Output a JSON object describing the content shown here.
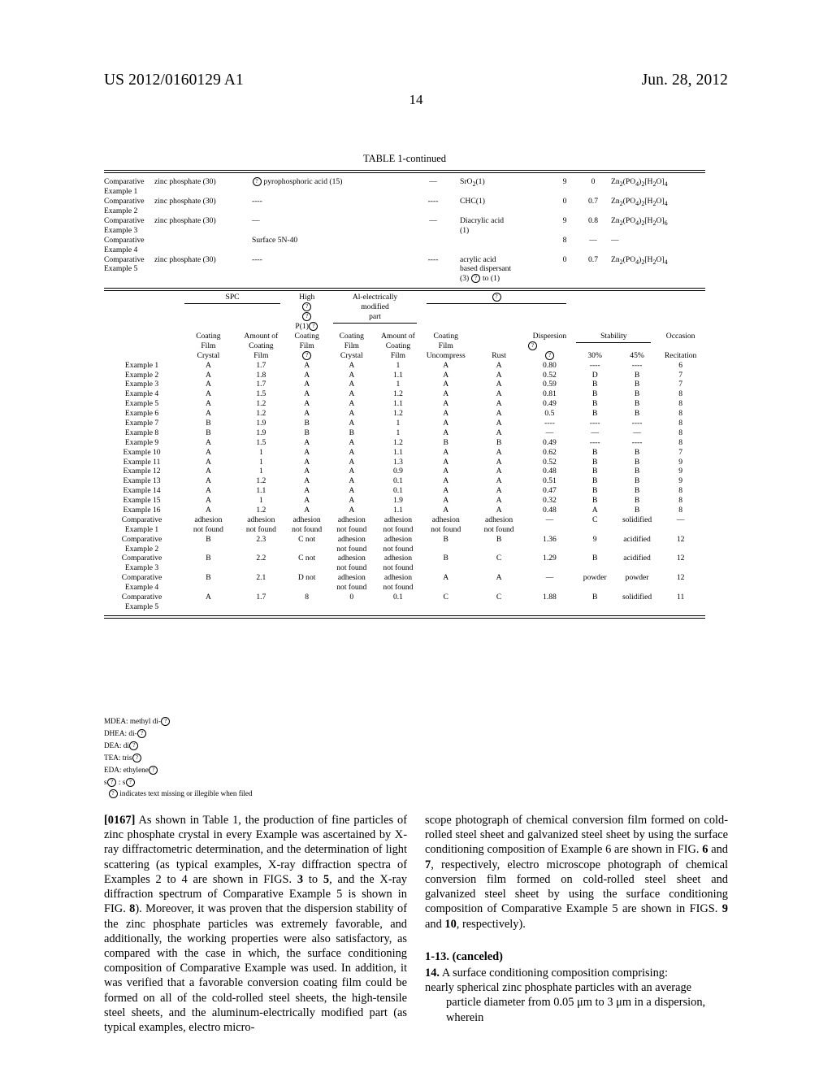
{
  "header": {
    "publication_number": "US 2012/0160129 A1",
    "publication_date": "Jun. 28, 2012",
    "page_number": "14"
  },
  "table": {
    "caption": "TABLE 1-continued",
    "upper_rows": [
      {
        "label_line1": "Comparative",
        "label_line2": "Example 1",
        "zinc": "zinc phosphate (30)",
        "acid": "pyrophosphoric acid (15)",
        "acid_has_marker": true,
        "dash": "—",
        "additive_line1": "SrO2(1)",
        "additive_line2": "",
        "n1": "9",
        "n2": "0",
        "formula": "Zn2(PO4)2[H2O]4"
      },
      {
        "label_line1": "Comparative",
        "label_line2": "Example 2",
        "zinc": "zinc phosphate (30)",
        "acid": "‐‐‐‐",
        "acid_has_marker": false,
        "dash": "‐‐‐‐",
        "additive_line1": "CHC(1)",
        "additive_line2": "",
        "n1": "0",
        "n2": "0.7",
        "formula": "Zn2(PO4)2[H2O]4"
      },
      {
        "label_line1": "Comparative",
        "label_line2": "Example 3",
        "zinc": "zinc phosphate (30)",
        "acid": "—",
        "acid_has_marker": false,
        "dash": "—",
        "additive_line1": "Diacrylic acid",
        "additive_line2": "(1)",
        "n1": "9",
        "n2": "0.8",
        "formula": "Zn2(PO4)2[H2O]6"
      },
      {
        "label_line1": "Comparative",
        "label_line2": "Example 4",
        "zinc": "",
        "acid": "Surface 5N-40",
        "acid_has_marker": false,
        "dash": "",
        "additive_line1": "",
        "additive_line2": "",
        "n1": "8",
        "n2": "—",
        "formula": "—"
      },
      {
        "label_line1": "Comparative",
        "label_line2": "Example 5",
        "zinc": "zinc phosphate (30)",
        "acid": "‐‐‐‐",
        "acid_has_marker": false,
        "dash": "‐‐‐‐",
        "additive_line1": "acrylic acid",
        "additive_line2": "based dispersant",
        "additive_line3": "(3) ⓝ to (1)",
        "n1": "0",
        "n2": "0.7",
        "formula": "Zn2(PO4)2[H2O]4"
      }
    ],
    "group_headers": {
      "spc": "SPC",
      "high_l1": "High",
      "high_l2": "ⓝ",
      "high_l3": "ⓝ",
      "high_l4": "P(1)ⓝ",
      "al_l1": "Al-electrically",
      "al_l2": "modified",
      "al_l3": "part",
      "disp_group": "ⓝ"
    },
    "col_headers_mid": [
      {
        "l1": "Coating",
        "l2": "Film"
      },
      {
        "l1": "Amount of",
        "l2": "Coating"
      },
      {
        "l1": "Coating",
        "l2": "Film"
      },
      {
        "l1": "Coating",
        "l2": "Film"
      },
      {
        "l1": "Amount of",
        "l2": "Coating"
      },
      {
        "l1": "Coating",
        "l2": "Film"
      },
      {
        "l1": "",
        "l2": ""
      },
      {
        "l1": "Dispersion",
        "l2": "ⓝ"
      },
      {
        "l1": "",
        "l2": "Stability"
      },
      {
        "l1": "",
        "l2": ""
      },
      {
        "l1": "",
        "l2": "Occasion"
      }
    ],
    "stability_label": "Stability",
    "occasion_label": "Occasion",
    "col_headers_sub": [
      "Crystal",
      "Film",
      "ⓝ",
      "Crystal",
      "Film",
      "Uncompress",
      "Rust",
      "ⓝ",
      "30%",
      "45%",
      "Recitation"
    ],
    "rows": [
      {
        "label": "Example 1",
        "label2": "",
        "cells": [
          "A",
          "1.7",
          "A",
          "A",
          "1",
          "A",
          "A",
          "0.80",
          "‐‐‐‐",
          "‐‐‐‐",
          "6"
        ]
      },
      {
        "label": "Example 2",
        "label2": "",
        "cells": [
          "A",
          "1.8",
          "A",
          "A",
          "1.1",
          "A",
          "A",
          "0.52",
          "D",
          "B",
          "7"
        ]
      },
      {
        "label": "Example 3",
        "label2": "",
        "cells": [
          "A",
          "1.7",
          "A",
          "A",
          "1",
          "A",
          "A",
          "0.59",
          "B",
          "B",
          "7"
        ]
      },
      {
        "label": "Example 4",
        "label2": "",
        "cells": [
          "A",
          "1.5",
          "A",
          "A",
          "1.2",
          "A",
          "A",
          "0.81",
          "B",
          "B",
          "8"
        ]
      },
      {
        "label": "Example 5",
        "label2": "",
        "cells": [
          "A",
          "1.2",
          "A",
          "A",
          "1.1",
          "A",
          "A",
          "0.49",
          "B",
          "B",
          "8"
        ]
      },
      {
        "label": "Example 6",
        "label2": "",
        "cells": [
          "A",
          "1.2",
          "A",
          "A",
          "1.2",
          "A",
          "A",
          "0.5",
          "B",
          "B",
          "8"
        ]
      },
      {
        "label": "Example 7",
        "label2": "",
        "cells": [
          "B",
          "1.9",
          "B",
          "A",
          "1",
          "A",
          "A",
          "‐‐‐‐",
          "‐‐‐‐",
          "‐‐‐‐",
          "8"
        ]
      },
      {
        "label": "Example 8",
        "label2": "",
        "cells": [
          "B",
          "1.9",
          "B",
          "B",
          "1",
          "A",
          "A",
          "—",
          "—",
          "—",
          "8"
        ]
      },
      {
        "label": "Example 9",
        "label2": "",
        "cells": [
          "A",
          "1.5",
          "A",
          "A",
          "1.2",
          "B",
          "B",
          "0.49",
          "‐‐‐‐",
          "‐‐‐‐",
          "8"
        ]
      },
      {
        "label": "Example 10",
        "label2": "",
        "cells": [
          "A",
          "1",
          "A",
          "A",
          "1.1",
          "A",
          "A",
          "0.62",
          "B",
          "B",
          "7"
        ]
      },
      {
        "label": "Example 11",
        "label2": "",
        "cells": [
          "A",
          "1",
          "A",
          "A",
          "1.3",
          "A",
          "A",
          "0.52",
          "B",
          "B",
          "9"
        ]
      },
      {
        "label": "Example 12",
        "label2": "",
        "cells": [
          "A",
          "1",
          "A",
          "A",
          "0.9",
          "A",
          "A",
          "0.48",
          "B",
          "B",
          "9"
        ]
      },
      {
        "label": "Example 13",
        "label2": "",
        "cells": [
          "A",
          "1.2",
          "A",
          "A",
          "0.1",
          "A",
          "A",
          "0.51",
          "B",
          "B",
          "9"
        ]
      },
      {
        "label": "Example 14",
        "label2": "",
        "cells": [
          "A",
          "1.1",
          "A",
          "A",
          "0.1",
          "A",
          "A",
          "0.47",
          "B",
          "B",
          "8"
        ]
      },
      {
        "label": "Example 15",
        "label2": "",
        "cells": [
          "A",
          "1",
          "A",
          "A",
          "1.9",
          "A",
          "A",
          "0.32",
          "B",
          "B",
          "8"
        ]
      },
      {
        "label": "Example 16",
        "label2": "",
        "cells": [
          "A",
          "1.2",
          "A",
          "A",
          "1.1",
          "A",
          "A",
          "0.48",
          "A",
          "B",
          "8"
        ]
      },
      {
        "label": "Comparative",
        "label2": "Example 1",
        "cells": [
          "adhesion\nnot found",
          "adhesion\nnot found",
          "adhesion\nnot found",
          "adhesion\nnot found",
          "adhesion\nnot found",
          "adhesion\nnot found",
          "adhesion\nnot found",
          "—",
          "C",
          "solidified",
          "—"
        ]
      },
      {
        "label": "Comparative",
        "label2": "Example 2",
        "cells": [
          "B",
          "2.3",
          "C not",
          "adhesion\nnot found",
          "adhesion\nnot found",
          "B",
          "B",
          "1.36",
          "9",
          "acidified",
          "12"
        ]
      },
      {
        "label": "Comparative",
        "label2": "Example 3",
        "cells": [
          "B",
          "2.2",
          "C not",
          "adhesion\nnot found",
          "adhesion\nnot found",
          "B",
          "C",
          "1.29",
          "B",
          "acidified",
          "12"
        ]
      },
      {
        "label": "Comparative",
        "label2": "Example 4",
        "cells": [
          "B",
          "2.1",
          "D not",
          "adhesion\nnot found",
          "adhesion\nnot found",
          "A",
          "A",
          "—",
          "powder",
          "powder",
          "12"
        ]
      },
      {
        "label": "Comparative",
        "label2": "Example 5",
        "cells": [
          "A",
          "1.7",
          "8",
          "0",
          "0.1",
          "C",
          "C",
          "1.88",
          "B",
          "solidified",
          "11"
        ]
      }
    ],
    "footnotes": [
      "MDEA: methyl di-ⓝ",
      "DHEA: di-ⓝ",
      "DEA: diⓝ",
      "TEA: trisⓝ",
      "EDA: ethyleneⓝ",
      "sⓝ : sⓝ",
      "ⓝ  indicates text missing or illegible when filed"
    ]
  },
  "body": {
    "left_paragraph_number": "[0167]",
    "left_paragraph": "As shown in Table 1, the production of fine particles of zinc phosphate crystal in every Example was ascertained by X-ray diffractometric determination, and the determination of light scattering (as typical examples, X-ray diffraction spectra of Examples 2 to 4 are shown in FIGS. 3 to 5, and the X-ray diffraction spectrum of Comparative Example 5 is shown in FIG. 8). Moreover, it was proven that the dispersion stability of the zinc phosphate particles was extremely favorable, and additionally, the working properties were also satisfactory, as compared with the case in which, the surface conditioning composition of Comparative Example was used. In addition, it was verified that a favorable conversion coating film could be formed on all of the cold-rolled steel sheets, the high-tensile steel sheets, and the aluminum-electrically modified part (as typical examples, electro micro-",
    "right_paragraph": "scope photograph of chemical conversion film formed on cold-rolled steel sheet and galvanized steel sheet by using the surface conditioning composition of Example 6 are shown in FIG. 6 and 7, respectively, electro microscope photograph of chemical conversion film formed on cold-rolled steel sheet and galvanized steel sheet by using the surface conditioning composition of Comparative Example 5 are shown in FIGS. 9 and 10, respectively).",
    "claims": {
      "canceled": "1-13. (canceled)",
      "claim14_number": "14.",
      "claim14_intro": "A surface conditioning composition comprising:",
      "claim14_body_line1": "nearly spherical zinc phosphate particles with an average",
      "claim14_body_line2": "particle diameter from 0.05 μm to 3 μm in a dispersion,",
      "claim14_body_line3": "wherein"
    }
  }
}
